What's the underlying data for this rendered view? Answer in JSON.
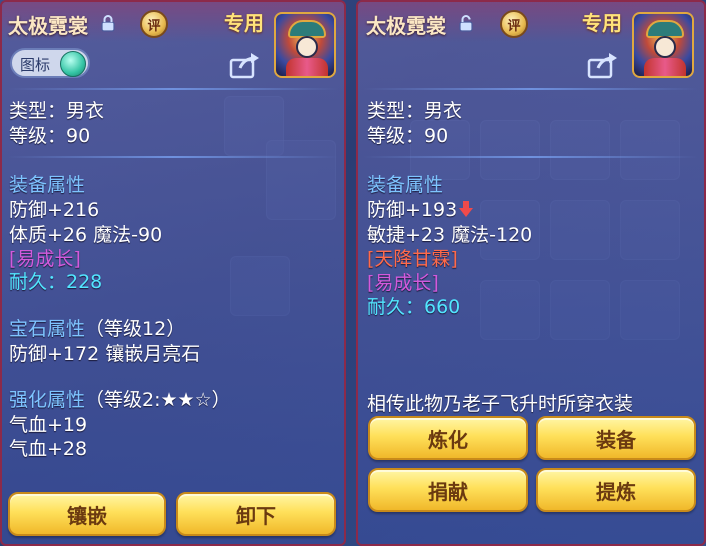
{
  "left": {
    "title": "太极霓裳",
    "rate_badge": "评",
    "exclusive": "专用",
    "icon_toggle_label": "图标",
    "lock_icon": "lock-closed-icon",
    "type_line": "类型：男衣",
    "level_line": "等级：90",
    "equip_section": "装备属性",
    "stat1": "防御+216",
    "stat2": "体质+26 魔法-90",
    "tag1": "[易成长]",
    "durability": "耐久：228",
    "gem_section": "宝石属性",
    "gem_level": "（等级12）",
    "gem_stat": "防御+172 镶嵌月亮石",
    "enhance_section": "强化属性",
    "enhance_level": "（等级2:★★☆）",
    "enhance_stat1": "气血+19",
    "enhance_stat2": "气血+28",
    "btn_inlay": "镶嵌",
    "btn_unequip": "卸下"
  },
  "right": {
    "title": "太极霓裳",
    "rate_badge": "评",
    "exclusive": "专用",
    "lock_icon": "lock-open-icon",
    "type_line": "类型：男衣",
    "level_line": "等级：90",
    "equip_section": "装备属性",
    "stat1": "防御+193",
    "stat2": "敏捷+23 魔法-120",
    "tag1": "[天降甘霖]",
    "tag2": "[易成长]",
    "durability": "耐久：660",
    "description": "相传此物乃老子飞升时所穿衣装",
    "btn_refine": "炼化",
    "btn_equip": "装备",
    "btn_donate": "捐献",
    "btn_extract": "提炼"
  },
  "colors": {
    "section": "#7ec4ff",
    "tag_purple": "#d25adc",
    "tag_orange": "#ff6a4a",
    "durability": "#52e6ff",
    "button": "#ffe05a"
  }
}
